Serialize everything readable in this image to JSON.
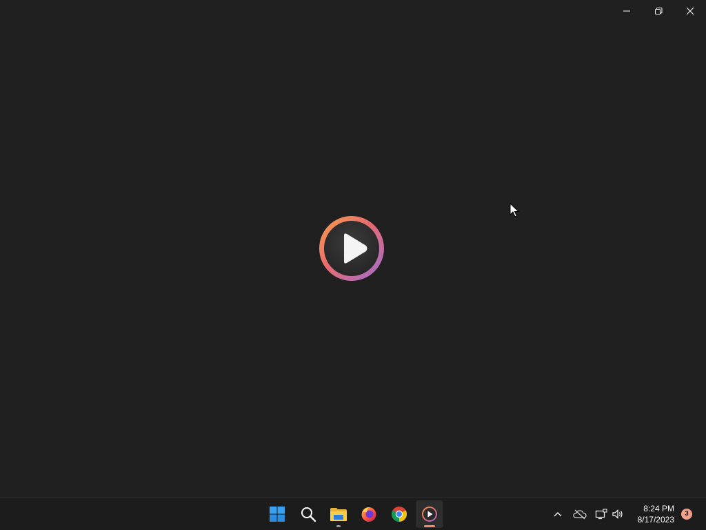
{
  "window": {
    "background": "#202020",
    "controls": [
      {
        "name": "minimize",
        "icon": "minimize-icon"
      },
      {
        "name": "restore",
        "icon": "restore-icon"
      },
      {
        "name": "close",
        "icon": "close-icon"
      }
    ]
  },
  "splash": {
    "icon": "media-player-play-logo-icon"
  },
  "taskbar": {
    "apps": [
      {
        "name": "Start",
        "icon": "windows-start-icon"
      },
      {
        "name": "Search",
        "icon": "search-icon"
      },
      {
        "name": "File Explorer",
        "icon": "folder-icon",
        "running": true
      },
      {
        "name": "Firefox",
        "icon": "firefox-icon"
      },
      {
        "name": "Chrome",
        "icon": "chrome-icon"
      },
      {
        "name": "Media Player",
        "icon": "media-player-icon",
        "active": true
      }
    ],
    "tray": {
      "icons": [
        "chevron-up-icon",
        "onedrive-offline-icon",
        "network-icon",
        "volume-icon"
      ]
    },
    "clock": {
      "time": "8:24 PM",
      "date": "8/17/2023"
    },
    "notifications": {
      "count": "3",
      "color": "#f4a08a"
    }
  },
  "colors": {
    "accent_active_indicator": "#f08a6e",
    "running_indicator": "#9a9a9a"
  }
}
